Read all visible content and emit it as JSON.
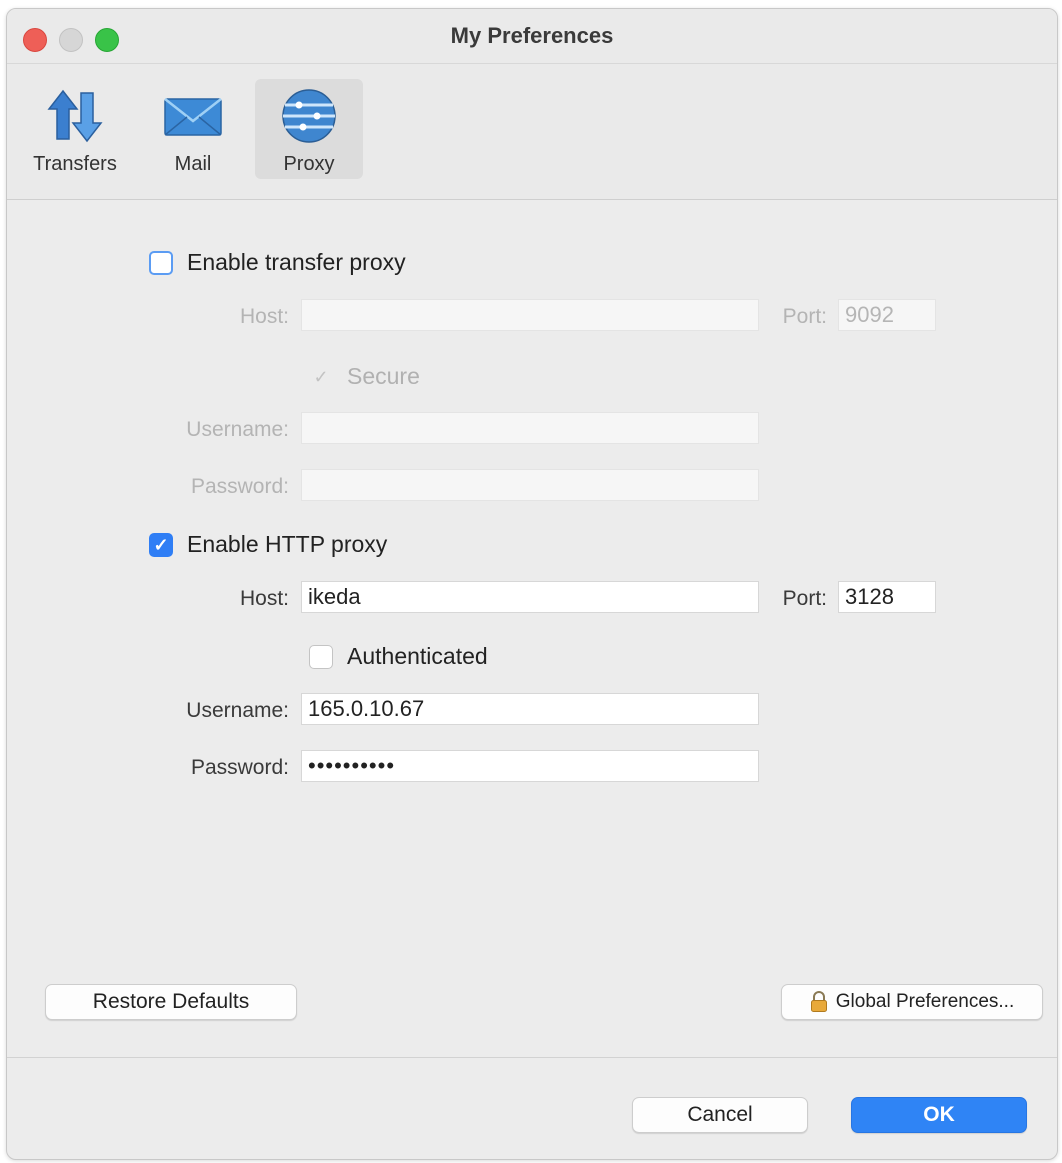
{
  "window": {
    "title": "My Preferences"
  },
  "toolbar": {
    "items": [
      {
        "label": "Transfers",
        "icon": "transfers-icon"
      },
      {
        "label": "Mail",
        "icon": "mail-icon"
      },
      {
        "label": "Proxy",
        "icon": "proxy-icon",
        "selected": true
      }
    ]
  },
  "transfer_proxy": {
    "enable_label": "Enable transfer proxy",
    "enabled": false,
    "host_label": "Host:",
    "host_value": "",
    "port_label": "Port:",
    "port_value": "9092",
    "secure_label": "Secure",
    "secure_checked": true,
    "username_label": "Username:",
    "username_value": "",
    "password_label": "Password:",
    "password_value": ""
  },
  "http_proxy": {
    "enable_label": "Enable HTTP proxy",
    "enabled": true,
    "host_label": "Host:",
    "host_value": "ikeda",
    "port_label": "Port:",
    "port_value": "3128",
    "authenticated_label": "Authenticated",
    "authenticated_checked": false,
    "username_label": "Username:",
    "username_value": "165.0.10.67",
    "password_label": "Password:",
    "password_value": "••••••••••"
  },
  "buttons": {
    "restore_defaults": "Restore Defaults",
    "global_preferences": "Global Preferences...",
    "cancel": "Cancel",
    "ok": "OK"
  },
  "colors": {
    "accent": "#2f84f5",
    "close": "#ee5f57",
    "maximize": "#39c348"
  }
}
